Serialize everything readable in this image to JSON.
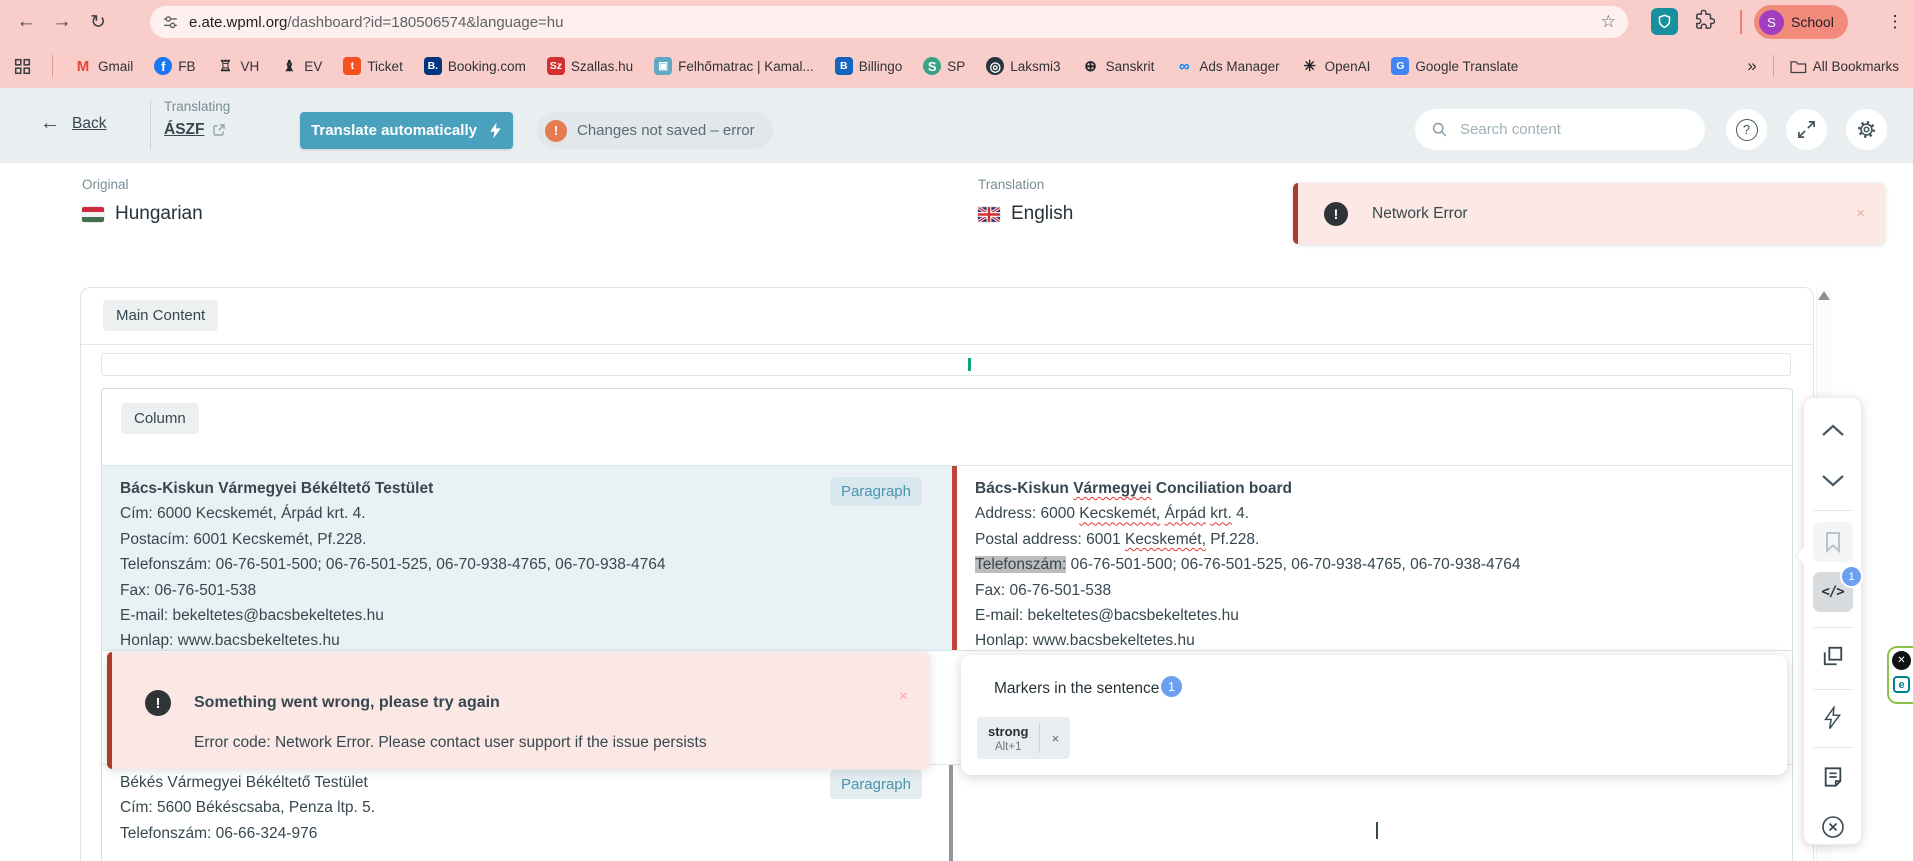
{
  "browser": {
    "url": {
      "host": "e.ate.wpml.org",
      "path": "/dashboard?id=180506574&language=hu"
    },
    "profile": {
      "initial": "S",
      "name": "School"
    },
    "overflow_chevron": "»",
    "all_bookmarks_label": "All Bookmarks",
    "bookmarks": [
      {
        "label": "Gmail",
        "icon": "gmail-favicon",
        "glyph": "M",
        "fg": "#ea4335",
        "bg": "none",
        "shape": "none"
      },
      {
        "label": "FB",
        "icon": "facebook-favicon",
        "glyph": "f",
        "fg": "#ffffff",
        "bg": "#1877f2",
        "shape": "circle"
      },
      {
        "label": "VH",
        "icon": "vh-favicon",
        "glyph": "♖",
        "fg": "#25292c",
        "bg": "none",
        "shape": "none"
      },
      {
        "label": "EV",
        "icon": "ev-favicon",
        "glyph": "♝",
        "fg": "#25292c",
        "bg": "none",
        "shape": "none"
      },
      {
        "label": "Ticket",
        "icon": "ticket-favicon",
        "glyph": "t",
        "fg": "#ffffff",
        "bg": "#f4511e",
        "shape": "rounded"
      },
      {
        "label": "Booking.com",
        "icon": "booking-favicon",
        "glyph": "B.",
        "fg": "#ffffff",
        "bg": "#003580",
        "shape": "rounded"
      },
      {
        "label": "Szallas.hu",
        "icon": "szallas-favicon",
        "glyph": "Sz",
        "fg": "#ffffff",
        "bg": "#d32f2f",
        "shape": "rounded"
      },
      {
        "label": "Felhőmatrac | Kamal...",
        "icon": "felhomatrac-favicon",
        "glyph": "▣",
        "fg": "#ffffff",
        "bg": "#62a8c3",
        "shape": "rounded"
      },
      {
        "label": "Billingo",
        "icon": "billingo-favicon",
        "glyph": "B",
        "fg": "#ffffff",
        "bg": "#1565c0",
        "shape": "rounded"
      },
      {
        "label": "SP",
        "icon": "sp-favicon",
        "glyph": "S",
        "fg": "#ffffff",
        "bg": "#39a388",
        "shape": "circle"
      },
      {
        "label": "Laksmi3",
        "icon": "laksmi3-favicon",
        "glyph": "◎",
        "fg": "#ffffff",
        "bg": "#26343c",
        "shape": "circle"
      },
      {
        "label": "Sanskrit",
        "icon": "sanskrit-favicon",
        "glyph": "⊕",
        "fg": "#1c2326",
        "bg": "none",
        "shape": "none"
      },
      {
        "label": "Ads Manager",
        "icon": "meta-favicon",
        "glyph": "∞",
        "fg": "#0082fb",
        "bg": "none",
        "shape": "none"
      },
      {
        "label": "OpenAI",
        "icon": "openai-favicon",
        "glyph": "✳",
        "fg": "#1c2326",
        "bg": "none",
        "shape": "none"
      },
      {
        "label": "Google Translate",
        "icon": "google-translate-favicon",
        "glyph": "G",
        "fg": "#ffffff",
        "bg": "#4285f4",
        "shape": "rounded"
      }
    ]
  },
  "toolbar": {
    "back_label": "Back",
    "translating_label": "Translating",
    "document_title": "ÁSZF",
    "translate_button_label": "Translate automatically",
    "status_message": "Changes not saved – error",
    "status_icon_glyph": "!",
    "search_placeholder": "Search content",
    "help_glyph": "?"
  },
  "language_header": {
    "original_label": "Original",
    "original_language": "Hungarian",
    "translation_label": "Translation",
    "translation_language": "English"
  },
  "network_toast": {
    "icon_glyph": "!",
    "message": "Network Error",
    "close_glyph": "×"
  },
  "editor": {
    "main_section_label": "Main Content",
    "column_label": "Column",
    "paragraph_chip_label": "Paragraph",
    "row1": {
      "source_lines": [
        {
          "bold": true,
          "segments": [
            {
              "t": "Bács-Kiskun Vármegyei Békéltető Testület"
            }
          ]
        },
        {
          "segments": [
            {
              "t": "Cím: 6000 Kecskemét, Árpád krt. 4."
            }
          ]
        },
        {
          "segments": [
            {
              "t": "Postacím: 6001 Kecskemét, Pf.228."
            }
          ]
        },
        {
          "segments": [
            {
              "t": "Telefonszám: 06-76-501-500; 06-76-501-525, 06-70-938-4765, 06-70-938-4764"
            }
          ]
        },
        {
          "segments": [
            {
              "t": "Fax: 06-76-501-538"
            }
          ]
        },
        {
          "segments": [
            {
              "t": "E-mail: bekeltetes@bacsbekeltetes.hu"
            }
          ]
        },
        {
          "segments": [
            {
              "t": "Honlap: www.bacsbekeltetes.hu"
            }
          ]
        }
      ],
      "target_lines": [
        {
          "bold": true,
          "segments": [
            {
              "t": "Bács-Kiskun "
            },
            {
              "t": "Vármegyei",
              "style": "squiggle"
            },
            {
              "t": " Conciliation board"
            }
          ]
        },
        {
          "segments": [
            {
              "t": "Address: 6000 "
            },
            {
              "t": "Kecskemét,",
              "style": "squiggle"
            },
            {
              "t": " "
            },
            {
              "t": "Árpád",
              "style": "squiggle"
            },
            {
              "t": " "
            },
            {
              "t": "krt.",
              "style": "squiggle"
            },
            {
              "t": " 4."
            }
          ]
        },
        {
          "segments": [
            {
              "t": "Postal address: 6001 "
            },
            {
              "t": "Kecskemét,",
              "style": "squiggle"
            },
            {
              "t": " Pf.228."
            }
          ]
        },
        {
          "segments": [
            {
              "t": "Telefonszám:",
              "style": "highlight"
            },
            {
              "t": " 06-76-501-500; 06-76-501-525, 06-70-938-4765, 06-70-938-4764"
            }
          ]
        },
        {
          "segments": [
            {
              "t": "Fax: 06-76-501-538"
            }
          ]
        },
        {
          "segments": [
            {
              "t": "E-mail: bekeltetes@bacsbekeltetes.hu"
            }
          ]
        },
        {
          "segments": [
            {
              "t": "Honlap: www.bacsbekeltetes.hu"
            }
          ]
        }
      ]
    },
    "row2": {
      "source_lines": [
        {
          "segments": [
            {
              "t": "Békés Vármegyei Békéltető Testület"
            }
          ]
        },
        {
          "segments": [
            {
              "t": "Cím: 5600 Békéscsaba, Penza ltp. 5."
            }
          ]
        },
        {
          "segments": [
            {
              "t": "Telefonszám: 06-66-324-976"
            }
          ]
        }
      ]
    }
  },
  "error_banner": {
    "icon_glyph": "!",
    "title": "Something went wrong, please try again",
    "body": "Error code: Network Error. Please contact user support if the issue persists",
    "close_glyph": "×"
  },
  "markers_panel": {
    "title": "Markers in the sentence",
    "count": "1",
    "marker": {
      "name": "strong",
      "shortcut": "Alt+1",
      "remove_glyph": "×"
    }
  },
  "sidebar": {
    "code_badge_count": "1",
    "code_glyph": "</>"
  },
  "extension_flyout": {
    "close_glyph": "✕",
    "letter": "e"
  },
  "colors": {
    "chrome_pink": "#f9cdca",
    "toolbar_gray": "#e9eef1",
    "accent_teal": "#49a1bd",
    "error_border": "#a93d2a",
    "error_bg": "#fbe8e4",
    "active_segment_bg": "#e9f1f4",
    "segment_divider_error": "#b8473a",
    "badge_blue": "#6d9ff1"
  }
}
